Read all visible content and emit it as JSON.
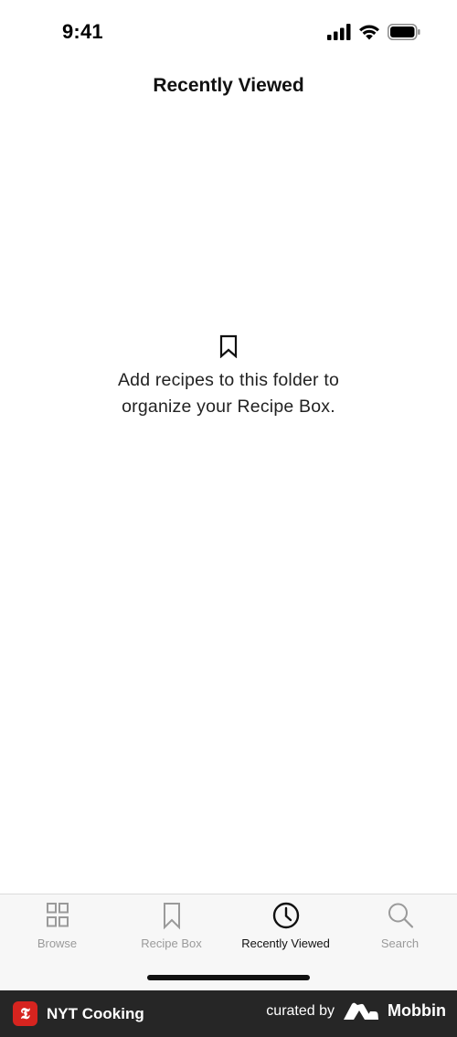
{
  "status_bar": {
    "time": "9:41",
    "icons": [
      "cellular-signal-icon",
      "wifi-icon",
      "battery-icon"
    ]
  },
  "header": {
    "title": "Recently Viewed"
  },
  "empty_state": {
    "icon": "bookmark-icon",
    "line1": "Add recipes to this folder to",
    "line2": "organize your Recipe Box."
  },
  "tab_bar": {
    "tabs": [
      {
        "label": "Browse",
        "icon": "grid-icon",
        "active": false
      },
      {
        "label": "Recipe Box",
        "icon": "bookmark-icon",
        "active": false
      },
      {
        "label": "Recently Viewed",
        "icon": "clock-icon",
        "active": true
      },
      {
        "label": "Search",
        "icon": "search-icon",
        "active": false
      }
    ],
    "active_color": "#111111",
    "inactive_color": "#9a9a9a"
  },
  "footer": {
    "app_name": "NYT Cooking",
    "curated_by": "curated by",
    "brand_name": "Mobbin",
    "app_logo_color": "#d6241f",
    "background": "#262626"
  }
}
